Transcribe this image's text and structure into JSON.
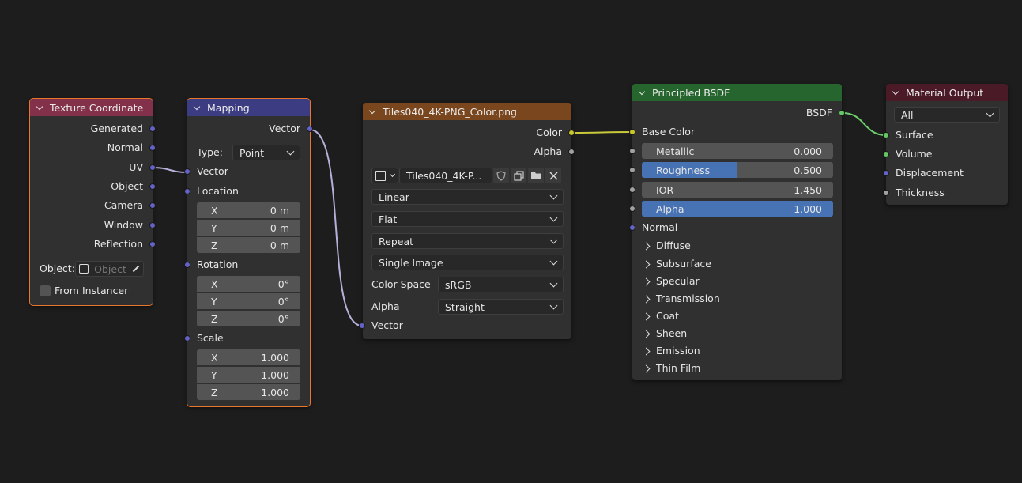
{
  "colors": {
    "background": "#1d1d1d",
    "node_body": "#303030",
    "header_input": "#83314a",
    "header_vector": "#3c3c83",
    "header_texture": "#79461d",
    "header_shader": "#27652e",
    "header_output": "#4a1a26",
    "selection": "#e8772b",
    "socket_vector": "#6363c7",
    "socket_color": "#c7c729",
    "socket_float": "#a1a1a1",
    "socket_shader": "#63c763",
    "slider_fill": "#4772b3"
  },
  "texture_coordinate": {
    "title": "Texture Coordinate",
    "outputs": [
      "Generated",
      "Normal",
      "UV",
      "Object",
      "Camera",
      "Window",
      "Reflection"
    ],
    "object_label": "Object:",
    "object_placeholder": "Object",
    "from_instancer": "From Instancer"
  },
  "mapping": {
    "title": "Mapping",
    "output": "Vector",
    "type_label": "Type:",
    "type_value": "Point",
    "vector_input": "Vector",
    "location": {
      "label": "Location",
      "x": "0 m",
      "y": "0 m",
      "z": "0 m"
    },
    "rotation": {
      "label": "Rotation",
      "x": "0°",
      "y": "0°",
      "z": "0°"
    },
    "scale": {
      "label": "Scale",
      "x": "1.000",
      "y": "1.000",
      "z": "1.000"
    },
    "axis": {
      "x": "X",
      "y": "Y",
      "z": "Z"
    }
  },
  "image_texture": {
    "title": "Tiles040_4K-PNG_Color.png",
    "out_color": "Color",
    "out_alpha": "Alpha",
    "image_name": "Tiles040_4K-P...",
    "interpolation": "Linear",
    "projection": "Flat",
    "extension": "Repeat",
    "source": "Single Image",
    "color_space_label": "Color Space",
    "color_space": "sRGB",
    "alpha_label": "Alpha",
    "alpha_mode": "Straight",
    "vector_input": "Vector"
  },
  "principled": {
    "title": "Principled BSDF",
    "output": "BSDF",
    "base_color": "Base Color",
    "metallic": {
      "label": "Metallic",
      "value": "0.000",
      "fraction": 0.0
    },
    "roughness": {
      "label": "Roughness",
      "value": "0.500",
      "fraction": 0.5
    },
    "ior": {
      "label": "IOR",
      "value": "1.450",
      "fraction": 0.0
    },
    "alpha": {
      "label": "Alpha",
      "value": "1.000",
      "fraction": 1.0
    },
    "normal": "Normal",
    "panels": [
      "Diffuse",
      "Subsurface",
      "Specular",
      "Transmission",
      "Coat",
      "Sheen",
      "Emission",
      "Thin Film"
    ]
  },
  "material_output": {
    "title": "Material Output",
    "target": "All",
    "inputs": [
      "Surface",
      "Volume",
      "Displacement",
      "Thickness"
    ]
  }
}
